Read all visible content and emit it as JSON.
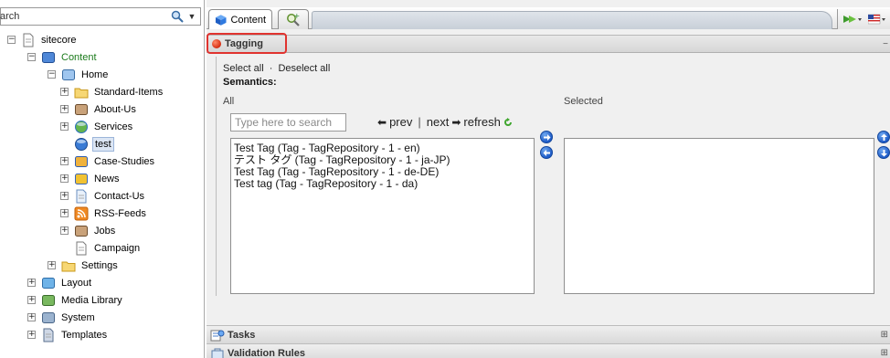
{
  "search": {
    "placeholder": "Search",
    "value": "arch"
  },
  "tree": {
    "items": [
      {
        "label": "sitecore",
        "icon": "page-icon",
        "expander": "⊟"
      },
      {
        "label": "Content",
        "icon": "content-icon",
        "expander": "⊟"
      },
      {
        "label": "Home",
        "icon": "home-icon",
        "expander": "⊟"
      },
      {
        "label": "Standard-Items",
        "icon": "folder-icon",
        "expander": "⊞"
      },
      {
        "label": "About-Us",
        "icon": "user-icon",
        "expander": "⊞"
      },
      {
        "label": "Services",
        "icon": "globe-icon",
        "expander": "⊞"
      },
      {
        "label": "test",
        "icon": "cup-icon",
        "expander": ""
      },
      {
        "label": "Case-Studies",
        "icon": "case-icon",
        "expander": "⊞"
      },
      {
        "label": "News",
        "icon": "news-icon",
        "expander": "⊞"
      },
      {
        "label": "Contact-Us",
        "icon": "contact-icon",
        "expander": "⊞"
      },
      {
        "label": "RSS-Feeds",
        "icon": "rss-icon",
        "expander": "⊞"
      },
      {
        "label": "Jobs",
        "icon": "user-icon",
        "expander": "⊞"
      },
      {
        "label": "Campaign",
        "icon": "page-icon",
        "expander": ""
      },
      {
        "label": "Settings",
        "icon": "folder-icon",
        "expander": "⊞"
      },
      {
        "label": "Layout",
        "icon": "layout-icon",
        "expander": "⊞"
      },
      {
        "label": "Media Library",
        "icon": "media-icon",
        "expander": "⊞"
      },
      {
        "label": "System",
        "icon": "system-icon",
        "expander": "⊞"
      },
      {
        "label": "Templates",
        "icon": "templates-icon",
        "expander": "⊞"
      }
    ]
  },
  "tabs": {
    "content_label": "Content"
  },
  "tagging": {
    "header": "Tagging",
    "select_all": "Select all",
    "separator": "·",
    "deselect_all": "Deselect all",
    "semantics_label": "Semantics:",
    "all_label": "All",
    "selected_label": "Selected",
    "search_placeholder": "Type here to search",
    "prev": "prev",
    "pipe": "|",
    "next": "next",
    "refresh": "refresh",
    "items": [
      "Test Tag (Tag - TagRepository - 1 - en)",
      "テスト タグ (Tag - TagRepository - 1 - ja-JP)",
      "Test Tag (Tag - TagRepository - 1 - de-DE)",
      "Test tag (Tag - TagRepository - 1 - da)"
    ]
  },
  "sections": {
    "tasks": "Tasks",
    "validation": "Validation Rules"
  },
  "colors": {
    "highlight": "#e0332f",
    "accent_blue": "#1e5cc8",
    "content_green": "#1a7a1a"
  }
}
